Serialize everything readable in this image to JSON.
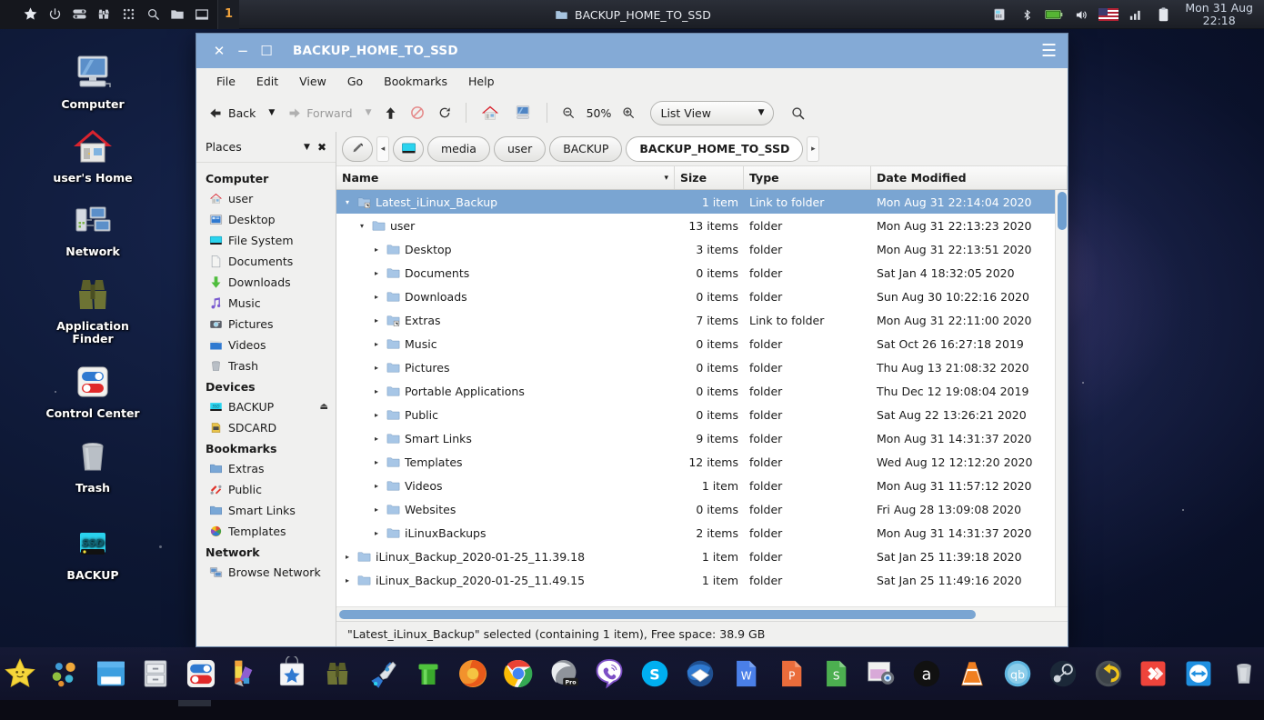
{
  "top_panel": {
    "launcher_icons": [
      "star-icon",
      "power-icon",
      "toggles-icon",
      "binoculars-icon",
      "grid-dots-icon",
      "search-icon",
      "folder-icon",
      "window-icon"
    ],
    "workspace": "1",
    "task_button": {
      "label": "BACKUP_HOME_TO_SSD",
      "icon": "folder-icon"
    },
    "tray_icons": [
      "phone-icon",
      "bluetooth-icon",
      "battery-icon",
      "volume-icon",
      "flag-us-icon",
      "signal-icon",
      "clipboard-icon"
    ],
    "clock": {
      "date": "Mon 31 Aug",
      "time": "22:18"
    }
  },
  "desktop_icons": [
    {
      "label": "Computer",
      "icon": "computer-icon"
    },
    {
      "label": "user's Home",
      "icon": "home-icon"
    },
    {
      "label": "Network",
      "icon": "network-icon"
    },
    {
      "label": "Application Finder",
      "icon": "binoculars-icon"
    },
    {
      "label": "Control Center",
      "icon": "control-center-icon"
    },
    {
      "label": "Trash",
      "icon": "trash-icon"
    },
    {
      "label": "BACKUP",
      "icon": "ssd-drive-icon"
    }
  ],
  "window": {
    "title": "BACKUP_HOME_TO_SSD",
    "close_label": "✕",
    "minimize_label": "−",
    "maximize_label": "☐",
    "menu_label": "☰",
    "menubar": [
      "File",
      "Edit",
      "View",
      "Go",
      "Bookmarks",
      "Help"
    ]
  },
  "toolbar": {
    "back_label": "Back",
    "forward_label": "Forward",
    "up_icon": "arrow-up-icon",
    "stop_icon": "stop-icon",
    "reload_icon": "reload-icon",
    "home_icon": "home-icon",
    "computer_icon": "computer-icon",
    "zoom_out_icon": "zoom-out-icon",
    "zoom_level": "50%",
    "zoom_in_icon": "zoom-in-icon",
    "view_mode": "List View",
    "search_icon": "search-icon"
  },
  "sidebar": {
    "header": "Places",
    "groups": [
      {
        "title": "Computer",
        "items": [
          {
            "label": "user",
            "icon": "home-icon"
          },
          {
            "label": "Desktop",
            "icon": "desktop-icon"
          },
          {
            "label": "File System",
            "icon": "harddisk-icon"
          },
          {
            "label": "Documents",
            "icon": "documents-icon"
          },
          {
            "label": "Downloads",
            "icon": "downloads-icon"
          },
          {
            "label": "Music",
            "icon": "music-icon"
          },
          {
            "label": "Pictures",
            "icon": "pictures-icon"
          },
          {
            "label": "Videos",
            "icon": "videos-icon"
          },
          {
            "label": "Trash",
            "icon": "trash-icon"
          }
        ]
      },
      {
        "title": "Devices",
        "items": [
          {
            "label": "BACKUP",
            "icon": "ssd-drive-icon",
            "eject": true
          },
          {
            "label": "SDCARD",
            "icon": "sdcard-icon"
          }
        ]
      },
      {
        "title": "Bookmarks",
        "items": [
          {
            "label": "Extras",
            "icon": "folder-icon"
          },
          {
            "label": "Public",
            "icon": "public-link-icon"
          },
          {
            "label": "Smart Links",
            "icon": "folder-icon"
          },
          {
            "label": "Templates",
            "icon": "templates-icon"
          }
        ]
      },
      {
        "title": "Network",
        "items": [
          {
            "label": "Browse Network",
            "icon": "network-browse-icon"
          }
        ]
      }
    ]
  },
  "pathbar": {
    "edit_icon": "pencil-icon",
    "scroll_left": "◂",
    "scroll_right": "▸",
    "crumbs": [
      {
        "label": "",
        "icon": "harddisk-icon",
        "current": false
      },
      {
        "label": "media",
        "current": false
      },
      {
        "label": "user",
        "current": false
      },
      {
        "label": "BACKUP",
        "current": false
      },
      {
        "label": "BACKUP_HOME_TO_SSD",
        "current": true
      }
    ]
  },
  "file_list": {
    "columns": [
      "Name",
      "Size",
      "Type",
      "Date Modified"
    ],
    "sort_caret": "▾",
    "rows": [
      {
        "name": "Latest_iLinux_Backup",
        "size": "1 item",
        "type": "Link to folder",
        "date": "Mon Aug 31 22:14:04 2020",
        "depth": 0,
        "twisty": "▾",
        "icon": "folder-link-icon",
        "selected": true
      },
      {
        "name": "user",
        "size": "13 items",
        "type": "folder",
        "date": "Mon Aug 31 22:13:23 2020",
        "depth": 1,
        "twisty": "▾",
        "icon": "folder-icon",
        "selected": false
      },
      {
        "name": "Desktop",
        "size": "3 items",
        "type": "folder",
        "date": "Mon Aug 31 22:13:51 2020",
        "depth": 2,
        "twisty": "▸",
        "icon": "folder-icon",
        "selected": false
      },
      {
        "name": "Documents",
        "size": "0 items",
        "type": "folder",
        "date": "Sat Jan  4 18:32:05 2020",
        "depth": 2,
        "twisty": "▸",
        "icon": "folder-icon",
        "selected": false
      },
      {
        "name": "Downloads",
        "size": "0 items",
        "type": "folder",
        "date": "Sun Aug 30 10:22:16 2020",
        "depth": 2,
        "twisty": "▸",
        "icon": "folder-icon",
        "selected": false
      },
      {
        "name": "Extras",
        "size": "7 items",
        "type": "Link to folder",
        "date": "Mon Aug 31 22:11:00 2020",
        "depth": 2,
        "twisty": "▸",
        "icon": "folder-link-icon",
        "selected": false
      },
      {
        "name": "Music",
        "size": "0 items",
        "type": "folder",
        "date": "Sat Oct 26 16:27:18 2019",
        "depth": 2,
        "twisty": "▸",
        "icon": "folder-icon",
        "selected": false
      },
      {
        "name": "Pictures",
        "size": "0 items",
        "type": "folder",
        "date": "Thu Aug 13 21:08:32 2020",
        "depth": 2,
        "twisty": "▸",
        "icon": "folder-icon",
        "selected": false
      },
      {
        "name": "Portable Applications",
        "size": "0 items",
        "type": "folder",
        "date": "Thu Dec 12 19:08:04 2019",
        "depth": 2,
        "twisty": "▸",
        "icon": "folder-icon",
        "selected": false
      },
      {
        "name": "Public",
        "size": "0 items",
        "type": "folder",
        "date": "Sat Aug 22 13:26:21 2020",
        "depth": 2,
        "twisty": "▸",
        "icon": "folder-icon",
        "selected": false
      },
      {
        "name": "Smart Links",
        "size": "9 items",
        "type": "folder",
        "date": "Mon Aug 31 14:31:37 2020",
        "depth": 2,
        "twisty": "▸",
        "icon": "folder-icon",
        "selected": false
      },
      {
        "name": "Templates",
        "size": "12 items",
        "type": "folder",
        "date": "Wed Aug 12 12:12:20 2020",
        "depth": 2,
        "twisty": "▸",
        "icon": "folder-icon",
        "selected": false
      },
      {
        "name": "Videos",
        "size": "1 item",
        "type": "folder",
        "date": "Mon Aug 31 11:57:12 2020",
        "depth": 2,
        "twisty": "▸",
        "icon": "folder-icon",
        "selected": false
      },
      {
        "name": "Websites",
        "size": "0 items",
        "type": "folder",
        "date": "Fri Aug 28 13:09:08 2020",
        "depth": 2,
        "twisty": "▸",
        "icon": "folder-icon",
        "selected": false
      },
      {
        "name": "iLinuxBackups",
        "size": "2 items",
        "type": "folder",
        "date": "Mon Aug 31 14:31:37 2020",
        "depth": 2,
        "twisty": "▸",
        "icon": "folder-icon",
        "selected": false
      },
      {
        "name": "iLinux_Backup_2020-01-25_11.39.18",
        "size": "1 item",
        "type": "folder",
        "date": "Sat Jan 25 11:39:18 2020",
        "depth": 0,
        "twisty": "▸",
        "icon": "folder-icon",
        "selected": false
      },
      {
        "name": "iLinux_Backup_2020-01-25_11.49.15",
        "size": "1 item",
        "type": "folder",
        "date": "Sat Jan 25 11:49:16 2020",
        "depth": 0,
        "twisty": "▸",
        "icon": "folder-icon",
        "selected": false
      }
    ]
  },
  "statusbar": {
    "text": "\"Latest_iLinux_Backup\" selected (containing 1 item), Free space: 38.9 GB"
  },
  "dock": {
    "items": [
      "star-smiley-icon",
      "dots-colored-icon",
      "file-browser-icon",
      "archive-drawer-icon",
      "control-center-icon",
      "color-palette-icon",
      "app-store-star-icon",
      "binoculars-icon",
      "rocket-icon",
      "green-pipe-icon",
      "firefox-icon",
      "chrome-icon",
      "opera-pro-icon",
      "viber-icon",
      "skype-icon",
      "thunderbird-icon",
      "word-icon",
      "powerpoint-icon",
      "sheets-icon",
      "screenshot-icon",
      "audacious-icon",
      "vlc-icon",
      "qbittorrent-icon",
      "steam-icon",
      "timeshift-icon",
      "anydesk-icon",
      "teamviewer-icon",
      "trash-icon"
    ]
  },
  "colors": {
    "titlebar": "#84aad6",
    "selection": "#7aa5d2",
    "panel_bg": "#1b1e25",
    "window_bg": "#f0f0ef"
  }
}
